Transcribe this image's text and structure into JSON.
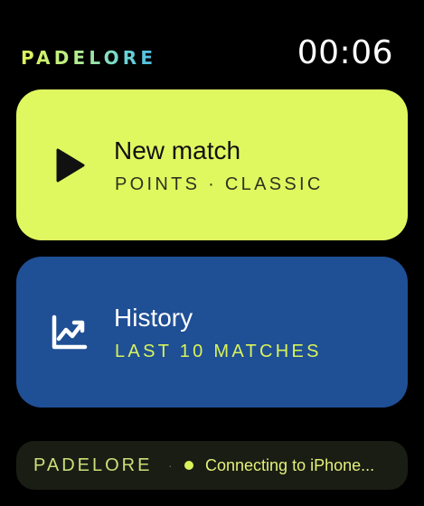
{
  "header": {
    "brand": "PADELORE",
    "time": "00:06"
  },
  "cards": {
    "new_match": {
      "title": "New match",
      "subtitle": "POINTS · CLASSIC",
      "icon": "play-icon",
      "background": "#e0f85f"
    },
    "history": {
      "title": "History",
      "subtitle": "LAST 10 MATCHES",
      "icon": "chart-trend-up-icon",
      "background": "#1f4f95"
    }
  },
  "status_bar": {
    "brand": "PADELORE",
    "separator": "·",
    "status_text": "Connecting to iPhone...",
    "status_dot_color": "#d8f35a"
  }
}
